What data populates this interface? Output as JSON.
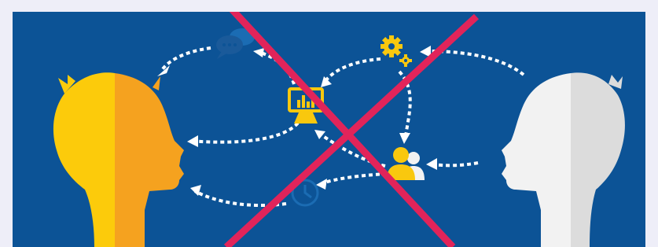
{
  "illustration": {
    "subject": "two-heads-communication-crossed-out",
    "icons": [
      "speech-bubble-icon",
      "monitor-chart-icon",
      "gears-icon",
      "people-icon",
      "clock-icon"
    ],
    "colors": {
      "background": "#0c5396",
      "left_head_light": "#fccb0b",
      "left_head_shade": "#f5a21f",
      "right_head_light": "#f2f2f2",
      "right_head_shade": "#dcdcdc",
      "arrows": "#ffffff",
      "icon_yellow": "#f9c80e",
      "icon_blue": "#1b6cb3",
      "cross": "#e1245a"
    }
  }
}
